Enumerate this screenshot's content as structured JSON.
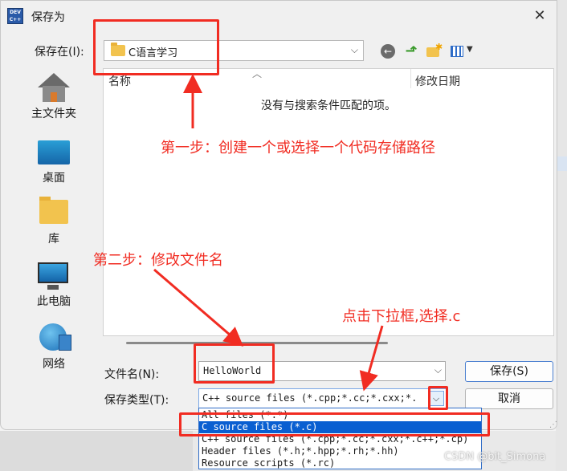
{
  "dialog": {
    "app_icon_text": "DEV C++",
    "title": "保存为",
    "close_label": "✕"
  },
  "location": {
    "label": "保存在(I):",
    "current": "C语言学习"
  },
  "places": [
    {
      "label": "主文件夹",
      "icon": "home-icon"
    },
    {
      "label": "桌面",
      "icon": "desktop-icon"
    },
    {
      "label": "库",
      "icon": "library-icon"
    },
    {
      "label": "此电脑",
      "icon": "this-pc-icon"
    },
    {
      "label": "网络",
      "icon": "network-icon"
    }
  ],
  "file_list": {
    "col_name": "名称",
    "col_date": "修改日期",
    "empty_message": "没有与搜索条件匹配的项。"
  },
  "filename": {
    "label": "文件名(N):",
    "value": "HelloWorld"
  },
  "file_type": {
    "label": "保存类型(T):",
    "value": "C++ source files (*.cpp;*.cc;*.cxx;*.",
    "options": [
      "All files (*.*)",
      "C source files (*.c)",
      "C++ source files (*.cpp;*.cc;*.cxx;*.c++;*.cp)",
      "Header files (*.h;*.hpp;*.rh;*.hh)",
      "Resource scripts (*.rc)"
    ],
    "selected_option": "C source files (*.c)"
  },
  "buttons": {
    "save": "保存(S)",
    "cancel": "取消"
  },
  "annotations": {
    "step1": "第一步：创建一个或选择一个代码存储路径",
    "step2": "第二步：修改文件名",
    "step3": "点击下拉框,选择.c",
    "color": "#f12c22"
  },
  "watermark": "CSDN @bit_Simona"
}
